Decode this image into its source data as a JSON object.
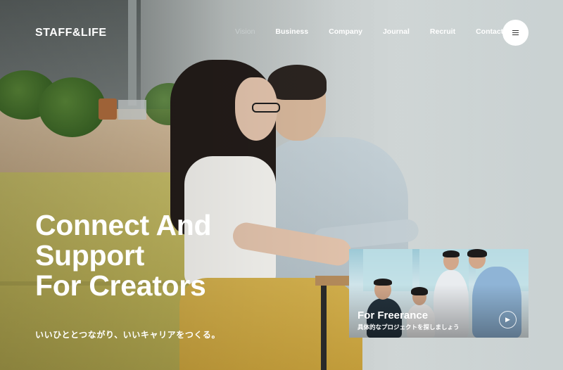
{
  "brand": {
    "logo_text": "STAFF&LIFE"
  },
  "nav": {
    "items": [
      {
        "label": "Vision",
        "active": true
      },
      {
        "label": "Business"
      },
      {
        "label": "Company"
      },
      {
        "label": "Journal"
      },
      {
        "label": "Recruit"
      },
      {
        "label": "Contact"
      }
    ],
    "menu_icon": "hamburger-icon"
  },
  "hero": {
    "headline": [
      "Connect And",
      "Support",
      "For Creators"
    ],
    "tagline": "いいひととつながり、いいキャリアをつくる。"
  },
  "card": {
    "title": "For Freerance",
    "subtitle": "具体的なプロジェクトを探しましょう",
    "arrow_icon": "chevron-right-icon"
  },
  "colors": {
    "text": "#ffffff",
    "sofa": "#c9c06a",
    "background": "#cfd4d4"
  }
}
